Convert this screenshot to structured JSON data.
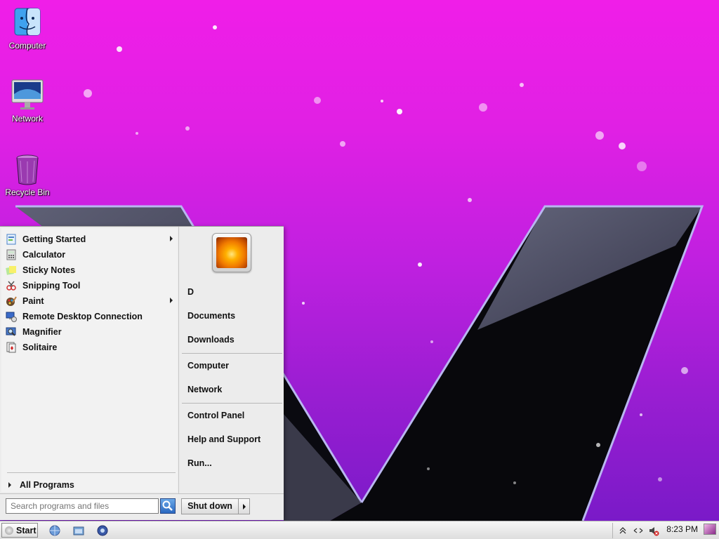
{
  "desktop": {
    "icons": [
      {
        "label": "Computer",
        "icon": "finder-computer-icon"
      },
      {
        "label": "Network",
        "icon": "monitor-network-icon"
      },
      {
        "label": "Recycle Bin",
        "icon": "recycle-bin-icon"
      }
    ]
  },
  "start_menu": {
    "programs": [
      {
        "label": "Getting Started",
        "icon": "getting-started-icon",
        "has_submenu": true
      },
      {
        "label": "Calculator",
        "icon": "calculator-icon",
        "has_submenu": false
      },
      {
        "label": "Sticky Notes",
        "icon": "sticky-notes-icon",
        "has_submenu": false
      },
      {
        "label": "Snipping Tool",
        "icon": "snipping-tool-icon",
        "has_submenu": false
      },
      {
        "label": "Paint",
        "icon": "paint-icon",
        "has_submenu": true
      },
      {
        "label": "Remote Desktop Connection",
        "icon": "remote-desktop-icon",
        "has_submenu": false
      },
      {
        "label": "Magnifier",
        "icon": "magnifier-icon",
        "has_submenu": false
      },
      {
        "label": "Solitaire",
        "icon": "solitaire-icon",
        "has_submenu": false
      }
    ],
    "all_programs": "All Programs",
    "right_items": [
      "D",
      "Documents",
      "Downloads",
      "Computer",
      "Network",
      "Control Panel",
      "Help and Support",
      "Run..."
    ],
    "search_placeholder": "Search programs and files",
    "shutdown_label": "Shut down"
  },
  "taskbar": {
    "start_label": "Start",
    "clock": "8:23 PM"
  },
  "colors": {
    "wallpaper_top": "#f01ee8",
    "wallpaper_bottom": "#7a1ac8",
    "menu_bg": "#ececec"
  }
}
